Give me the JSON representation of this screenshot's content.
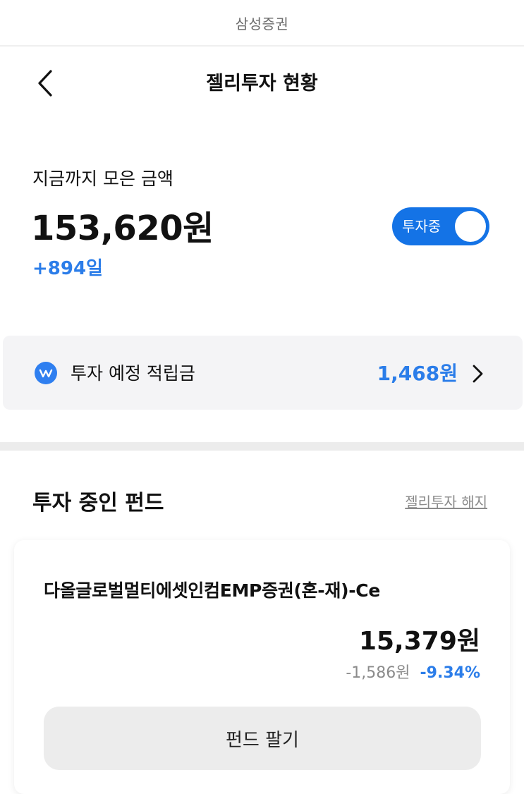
{
  "status_bar": {
    "title": "삼성증권"
  },
  "header": {
    "title": "젤리투자 현황"
  },
  "summary": {
    "label": "지금까지 모은 금액",
    "amount": "153,620원",
    "days": "+894일",
    "toggle_label": "투자중",
    "toggle_on": true
  },
  "deposit": {
    "label": "투자 예정 적립금",
    "amount": "1,468원"
  },
  "funds_section": {
    "title": "투자 중인 펀드",
    "cancel_link": "젤리투자 해지"
  },
  "fund": {
    "name": "다올글로벌멀티에셋인컴EMP증권(혼-재)-Ce",
    "value": "15,379원",
    "change_amount": "-1,586원",
    "change_rate": "-9.34%",
    "sell_label": "펀드 팔기"
  },
  "colors": {
    "accent": "#1473e6",
    "positive_text": "#2b7de9",
    "card_bg": "#f4f4f6"
  },
  "icons": {
    "back": "chevron-left-icon",
    "deposit": "won-coin-icon",
    "deposit_arrow": "chevron-right-icon"
  }
}
